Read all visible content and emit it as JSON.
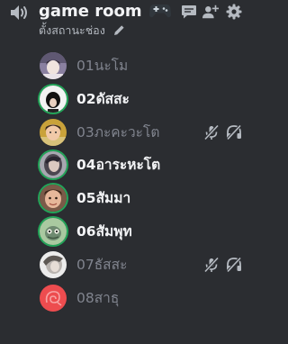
{
  "channel": {
    "name": "game room",
    "status": "ตั้งสถานะช่อง",
    "icons": [
      "speaker-icon",
      "gamepad-emoji-icon",
      "chat-icon",
      "add-user-icon",
      "gear-icon",
      "pencil-icon"
    ]
  },
  "colors": {
    "background": "#2b2d31",
    "speaking_ring": "#23a559",
    "muted_text": "#80848e",
    "active_text": "#f2f3f5"
  },
  "users": [
    {
      "name": "01นะโม",
      "speaking": false,
      "self_muted": false
    },
    {
      "name": "02ดัสสะ",
      "speaking": true,
      "self_muted": false
    },
    {
      "name": "03ภะคะวะโต",
      "speaking": false,
      "self_muted": true
    },
    {
      "name": "04อาระหะโต",
      "speaking": true,
      "self_muted": false
    },
    {
      "name": "05สัมมา",
      "speaking": true,
      "self_muted": false
    },
    {
      "name": "06สัมพุท",
      "speaking": true,
      "self_muted": false
    },
    {
      "name": "07ธัสสะ",
      "speaking": false,
      "self_muted": true
    },
    {
      "name": "08สาธุ",
      "speaking": false,
      "self_muted": false
    }
  ]
}
